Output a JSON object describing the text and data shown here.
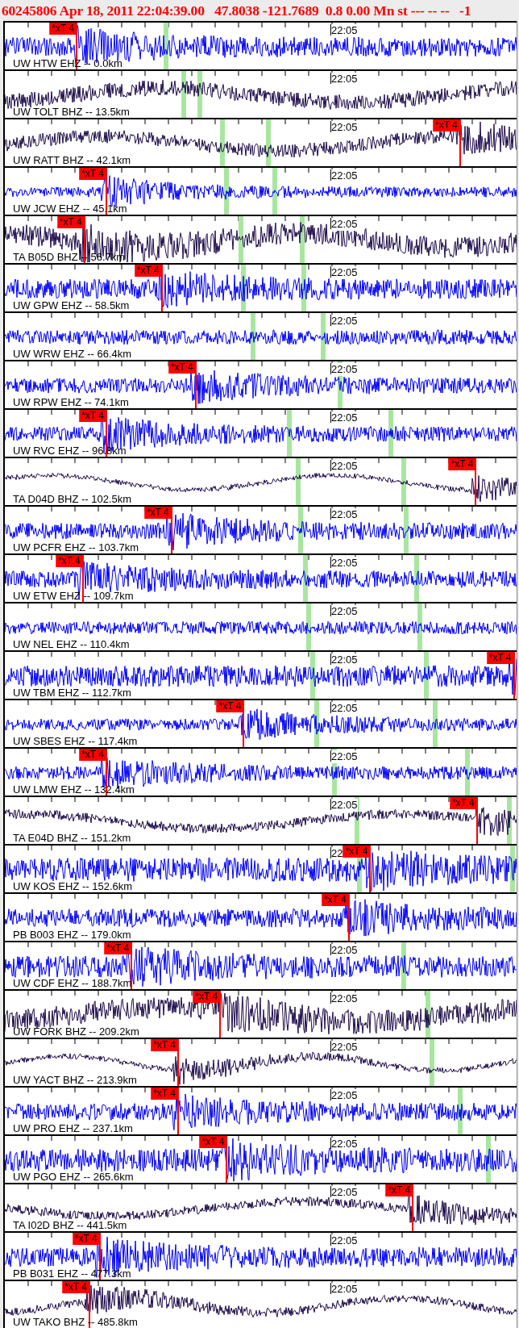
{
  "header": {
    "title": "60245806 Apr 18, 2011 22:04:39.00   47.8038 -121.7689  0.8 0.00 Mn st --- -- --   -1"
  },
  "traces": [
    {
      "label": "UW HTW EHZ -- 0.0km",
      "color": "#0000ff",
      "time_label": "22:05",
      "pick": {
        "text": "*xT 4",
        "level": 0.14
      },
      "phase_marks": [
        {
          "level": 0.315
        }
      ]
    },
    {
      "label": "UW TOLT BHZ -- 13.5km",
      "color": "#1e0b4a",
      "time_label": "22:05",
      "phase_marks": [
        {
          "level": 0.349
        },
        {
          "level": 0.381
        }
      ]
    },
    {
      "label": "UW RATT BHZ -- 42.1km",
      "color": "#1e0b4a",
      "time_label": "22:05",
      "pick": {
        "text": "*xT 4",
        "level": 0.888
      },
      "phase_marks": [
        {
          "level": 0.425
        },
        {
          "level": 0.514
        }
      ]
    },
    {
      "label": "UW JCW EHZ -- 45.1km",
      "color": "#0000ff",
      "time_label": "22:05",
      "pick": {
        "text": "*xT 4",
        "level": 0.198
      },
      "phase_marks": [
        {
          "level": 0.433
        },
        {
          "level": 0.527
        }
      ]
    },
    {
      "label": "TA B05D BHZ -- 56.7km",
      "color": "#1e0b4a",
      "time_label": "22:05",
      "pick": {
        "text": "*xT 4",
        "level": 0.155
      },
      "phase_marks": [
        {
          "level": 0.461
        },
        {
          "level": 0.58
        }
      ]
    },
    {
      "label": "UW GPW EHZ -- 58.5km",
      "color": "#0000ff",
      "time_label": "22:05",
      "pick": {
        "text": "*xT 4",
        "level": 0.306
      },
      "phase_marks": [
        {
          "level": 0.466
        },
        {
          "level": 0.583
        }
      ]
    },
    {
      "label": "UW WRW EHZ -- 66.4km",
      "color": "#0000ff",
      "time_label": "22:05",
      "phase_marks": [
        {
          "level": 0.484
        },
        {
          "level": 0.621
        }
      ]
    },
    {
      "label": "UW RPW EHZ -- 74.1km",
      "color": "#0000ff",
      "time_label": "22:05",
      "pick": {
        "text": "*xT 4",
        "level": 0.372
      },
      "phase_marks": [
        {
          "level": 0.654
        }
      ]
    },
    {
      "label": "UW RVC EHZ -- 96.8km",
      "color": "#0000ff",
      "time_label": "22:05",
      "pick": {
        "text": "*xT 4",
        "level": 0.198
      },
      "phase_marks": [
        {
          "level": 0.555
        },
        {
          "level": 0.753
        }
      ]
    },
    {
      "label": "TA D04D BHZ -- 102.5km",
      "color": "#1e0b4a",
      "time_label": "22:05",
      "pick": {
        "text": "*xT 4",
        "level": 0.919
      },
      "phase_marks": [
        {
          "level": 0.573
        },
        {
          "level": 0.779
        }
      ]
    },
    {
      "label": "UW PCFR EHZ -- 103.7km",
      "color": "#0000ff",
      "time_label": "22:05",
      "pick": {
        "text": "*xT 4",
        "level": 0.325
      },
      "phase_marks": [
        {
          "level": 0.577
        },
        {
          "level": 0.783
        }
      ]
    },
    {
      "label": "UW ETW EHZ -- 109.7km",
      "color": "#0000ff",
      "time_label": "22:05",
      "pick": {
        "text": "*xT 4",
        "level": 0.152
      },
      "phase_marks": [
        {
          "level": 0.586
        },
        {
          "level": 0.804
        }
      ]
    },
    {
      "label": "UW NEL EHZ -- 110.4km",
      "color": "#0000ff",
      "time_label": "22:05",
      "phase_marks": [
        {
          "level": 0.593
        },
        {
          "level": 0.81
        }
      ]
    },
    {
      "label": "UW TBM EHZ -- 112.7km",
      "color": "#0000ff",
      "time_label": "22:05",
      "pick": {
        "text": "*xT 4",
        "level": 0.993
      },
      "phase_marks": [
        {
          "level": 0.6
        },
        {
          "level": 0.822
        }
      ]
    },
    {
      "label": "UW SBES EHZ -- 117.4km",
      "color": "#0000ff",
      "time_label": "22:05",
      "pick": {
        "text": "*xT 4",
        "level": 0.466
      },
      "phase_marks": [
        {
          "level": 0.608
        },
        {
          "level": 0.84
        }
      ]
    },
    {
      "label": "UW LMW EHZ -- 132.4km",
      "color": "#0000ff",
      "time_label": "22:05",
      "pick": {
        "text": "*xT 4",
        "level": 0.198
      },
      "phase_marks": [
        {
          "level": 0.643
        },
        {
          "level": 0.903
        }
      ]
    },
    {
      "label": "TA E04D BHZ -- 151.2km",
      "color": "#1e0b4a",
      "time_label": "22:05",
      "pick": {
        "text": "*xT 4",
        "level": 0.921
      },
      "phase_marks": [
        {
          "level": 0.687
        },
        {
          "level": 0.985
        }
      ]
    },
    {
      "label": "UW KOS EHZ -- 152.6km",
      "color": "#0000ff",
      "time_label": "22",
      "pick": {
        "text": "*xT 4",
        "level": 0.713
      },
      "phase_marks": [
        {
          "level": 0.692
        },
        {
          "level": 0.99
        }
      ]
    },
    {
      "label": "PB B003 EHZ -- 179.0km",
      "color": "#0000ff",
      "pick": {
        "text": "*xT 4",
        "level": 0.671
      }
    },
    {
      "label": "UW CDF EHZ -- 188.7km",
      "color": "#0000ff",
      "time_label": "22:05",
      "pick": {
        "text": "*xT 4",
        "level": 0.247
      },
      "phase_marks": [
        {
          "level": 0.778
        }
      ]
    },
    {
      "label": "UW FORK BHZ -- 209.2km",
      "color": "#1e0b4a",
      "time_label": "22:05",
      "pick": {
        "text": "*xT 4",
        "level": 0.42
      },
      "phase_marks": [
        {
          "level": 0.825
        }
      ]
    },
    {
      "label": "UW YACT BHZ -- 213.9km",
      "color": "#1e0b4a",
      "time_label": "22:05",
      "pick": {
        "text": "*xT 4",
        "level": 0.338
      },
      "phase_marks": [
        {
          "level": 0.834
        }
      ]
    },
    {
      "label": "UW PRO EHZ -- 237.1km",
      "color": "#0000ff",
      "time_label": "22:05",
      "pick": {
        "text": "*xT 4",
        "level": 0.338
      },
      "phase_marks": [
        {
          "level": 0.888
        }
      ]
    },
    {
      "label": "UW PGO EHZ -- 265.6km",
      "color": "#0000ff",
      "time_label": "22:05",
      "pick": {
        "text": "*xT 4",
        "level": 0.433
      },
      "phase_marks": [
        {
          "level": 0.944
        }
      ]
    },
    {
      "label": "TA I02D BHZ -- 441.5km",
      "color": "#1e0b4a",
      "time_label": "22:05",
      "pick": {
        "text": "*xT 4",
        "level": 0.796
      }
    },
    {
      "label": "PB B031 EHZ -- 477.3km",
      "color": "#0000ff",
      "time_label": "22:05",
      "pick": {
        "text": "*xT 4",
        "level": 0.185
      }
    },
    {
      "label": "UW TAKO BHZ -- 485.8km",
      "color": "#1e0b4a",
      "time_label": "22:05",
      "pick": {
        "text": "*xT 4",
        "level": 0.165
      }
    }
  ]
}
